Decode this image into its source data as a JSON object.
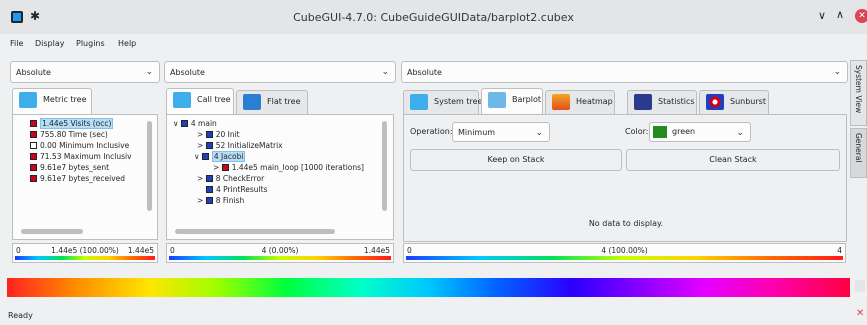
{
  "window": {
    "title": "CubeGUI-4.7.0: CubeGuideGUIData/barplot2.cubex"
  },
  "menu": [
    "File",
    "Display",
    "Plugins",
    "Help"
  ],
  "left": {
    "combo": "Absolute",
    "tabs": [
      "Metric tree"
    ],
    "rows": [
      {
        "label": "1.44e5 Visits (occ)",
        "color": "#d0021b",
        "selected": true
      },
      {
        "label": "755.80 Time (sec)",
        "color": "#d0021b"
      },
      {
        "label": "0.00 Minimum Inclusive",
        "color": "#ffffff"
      },
      {
        "label": "71.53 Maximum Inclusiv",
        "color": "#d0021b"
      },
      {
        "label": "9.61e7 bytes_sent",
        "color": "#d0021b"
      },
      {
        "label": "9.61e7 bytes_received",
        "color": "#d0021b"
      }
    ],
    "scale": {
      "lo": "0",
      "mid": "1.44e5 (100.00%)",
      "hi": "1.44e5"
    }
  },
  "middle": {
    "combo": "Absolute",
    "tabs": [
      "Call tree",
      "Flat tree"
    ],
    "rows": [
      {
        "label": "4 main",
        "chevron": "∨"
      },
      {
        "label": "20 Init",
        "chevron": ">"
      },
      {
        "label": "52 InitializeMatrix",
        "chevron": ">"
      },
      {
        "label": "4 Jacobi",
        "chevron": "∨",
        "selected": true
      },
      {
        "label": "1.44e5 main_loop [1000 iterations]",
        "chevron": ">",
        "red": true
      },
      {
        "label": "8 CheckError",
        "chevron": ">"
      },
      {
        "label": "4 PrintResults",
        "chevron": ""
      },
      {
        "label": "8 Finish",
        "chevron": ">"
      }
    ],
    "scale": {
      "lo": "0",
      "mid": "4 (0.00%)",
      "hi": "1.44e5"
    }
  },
  "right": {
    "combo": "Absolute",
    "tabs": [
      "System tree",
      "Barplot",
      "Heatmap",
      "Statistics",
      "Sunburst"
    ],
    "operation_label": "Operation:",
    "operation_value": "Minimum",
    "color_label": "Color:",
    "color_value": "green",
    "color_swatch": "#1e8c1e",
    "keep_btn": "Keep on Stack",
    "clean_btn": "Clean Stack",
    "empty_msg": "No data to display.",
    "scale": {
      "lo": "0",
      "mid": "4 (100.00%)",
      "hi": "4"
    }
  },
  "side_tabs": [
    "System View",
    "General"
  ],
  "status": "Ready"
}
